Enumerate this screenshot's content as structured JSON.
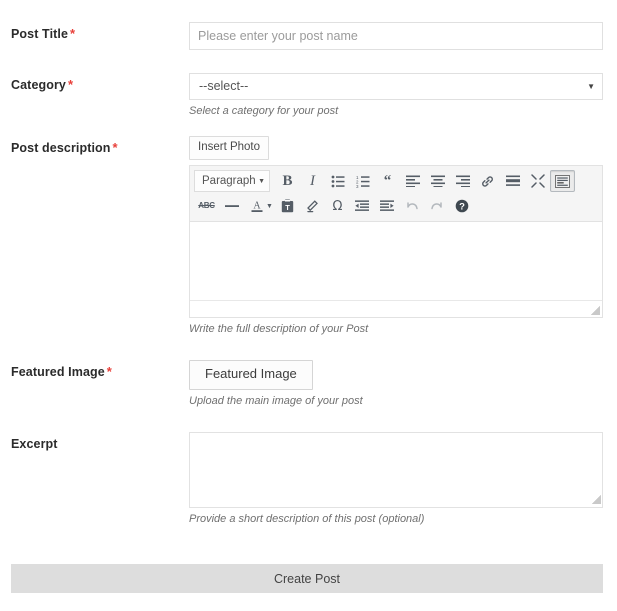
{
  "form": {
    "post_title": {
      "label": "Post Title",
      "required_mark": "*",
      "placeholder": "Please enter your post name",
      "value": ""
    },
    "category": {
      "label": "Category",
      "required_mark": "*",
      "selected": "--select--",
      "help": "Select a category for your post",
      "options": [
        "--select--"
      ]
    },
    "post_description": {
      "label": "Post description",
      "required_mark": "*",
      "insert_photo_label": "Insert Photo",
      "help": "Write the full description of your Post",
      "content": "",
      "toolbar": {
        "format_select": "Paragraph",
        "row1": [
          {
            "name": "bold",
            "title": "Bold"
          },
          {
            "name": "italic",
            "title": "Italic"
          },
          {
            "name": "bullist",
            "title": "Bulleted list"
          },
          {
            "name": "numlist",
            "title": "Numbered list"
          },
          {
            "name": "blockquote",
            "title": "Blockquote"
          },
          {
            "name": "alignleft",
            "title": "Align left"
          },
          {
            "name": "aligncenter",
            "title": "Align center"
          },
          {
            "name": "alignright",
            "title": "Align right"
          },
          {
            "name": "link",
            "title": "Insert/edit link"
          },
          {
            "name": "more",
            "title": "Insert Read More tag"
          },
          {
            "name": "fullscreen",
            "title": "Distraction-free writing mode"
          },
          {
            "name": "toolbar-toggle",
            "title": "Toolbar Toggle",
            "active": true
          }
        ],
        "row2": [
          {
            "name": "strikethrough",
            "title": "Strikethrough"
          },
          {
            "name": "hr",
            "title": "Horizontal line"
          },
          {
            "name": "forecolor",
            "title": "Text color"
          },
          {
            "name": "pastetext",
            "title": "Paste as text"
          },
          {
            "name": "removeformat",
            "title": "Clear formatting"
          },
          {
            "name": "charmap",
            "title": "Special character"
          },
          {
            "name": "outdent",
            "title": "Decrease indent"
          },
          {
            "name": "indent",
            "title": "Increase indent"
          },
          {
            "name": "undo",
            "title": "Undo"
          },
          {
            "name": "redo",
            "title": "Redo"
          },
          {
            "name": "help",
            "title": "Keyboard Shortcuts"
          }
        ]
      }
    },
    "featured_image": {
      "label": "Featured Image",
      "required_mark": "*",
      "button_label": "Featured Image",
      "help": "Upload the main image of your post"
    },
    "excerpt": {
      "label": "Excerpt",
      "placeholder": "",
      "value": "",
      "help": "Provide a short description of this post (optional)"
    },
    "submit": {
      "label": "Create Post"
    }
  },
  "colors": {
    "required": "#e8403a",
    "border": "#e0e0e0",
    "toolbar_bg": "#f5f5f5",
    "submit_bg": "#dddddd",
    "icon": "#555d66"
  }
}
